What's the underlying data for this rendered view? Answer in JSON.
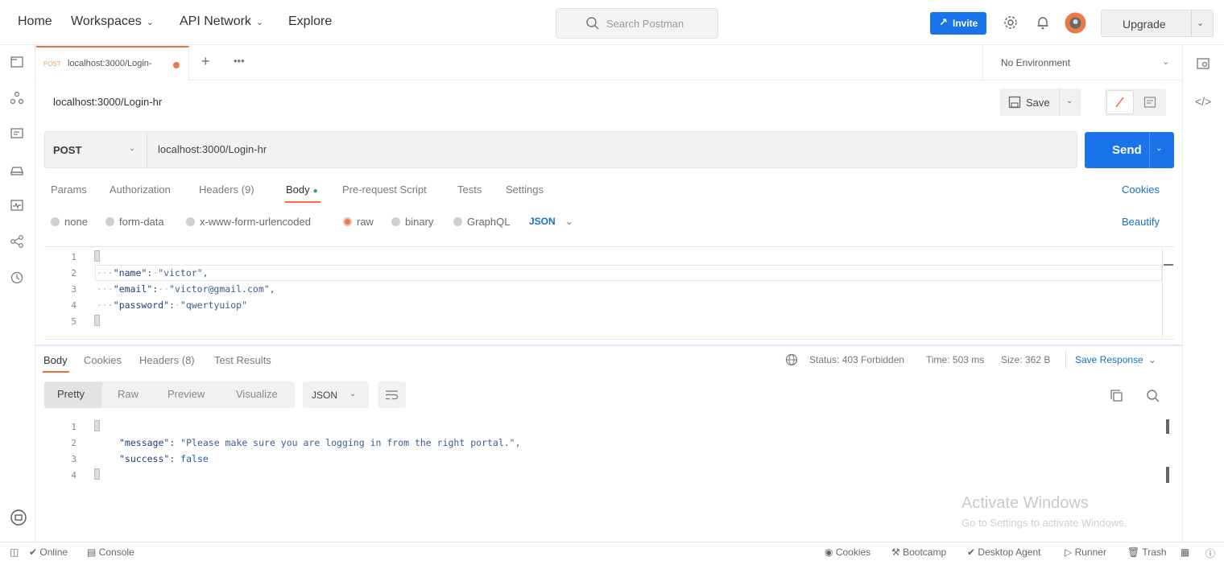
{
  "topnav": {
    "home": "Home",
    "workspaces": "Workspaces",
    "api_network": "API Network",
    "explore": "Explore",
    "search_placeholder": "Search Postman",
    "invite": "Invite",
    "upgrade": "Upgrade"
  },
  "tab": {
    "method": "POST",
    "url": "localhost:3000/Login-"
  },
  "environment": "No Environment",
  "request": {
    "title": "localhost:3000/Login-hr",
    "save": "Save",
    "method": "POST",
    "url": "localhost:3000/Login-hr",
    "send": "Send",
    "tabs": [
      "Params",
      "Authorization",
      "Headers (9)",
      "Body",
      "Pre-request Script",
      "Tests",
      "Settings"
    ],
    "cookies": "Cookies",
    "body_types": [
      "none",
      "form-data",
      "x-www-form-urlencoded",
      "raw",
      "binary",
      "GraphQL"
    ],
    "body_format": "JSON",
    "beautify": "Beautify",
    "body_lines": [
      {
        "n": "1",
        "text": "{"
      },
      {
        "n": "2",
        "key": "\"name\"",
        "value": "\"victor\","
      },
      {
        "n": "3",
        "key": "\"email\"",
        "value": "\"victor@gmail.com\","
      },
      {
        "n": "4",
        "key": "\"password\"",
        "value": "\"qwertyuiop\""
      },
      {
        "n": "5",
        "text": "}"
      }
    ]
  },
  "response": {
    "tabs": [
      "Body",
      "Cookies",
      "Headers (8)",
      "Test Results"
    ],
    "status": "Status: 403 Forbidden",
    "time": "Time: 503 ms",
    "size": "Size: 362 B",
    "save_response": "Save Response",
    "views": [
      "Pretty",
      "Raw",
      "Preview",
      "Visualize"
    ],
    "format": "JSON",
    "lines": [
      {
        "n": "1",
        "text": "{"
      },
      {
        "n": "2",
        "key": "\"message\"",
        "value": "\"Please make sure you are logging in from the right portal.\","
      },
      {
        "n": "3",
        "key": "\"success\"",
        "value": "false"
      },
      {
        "n": "4",
        "text": "}"
      }
    ]
  },
  "watermark": {
    "title": "Activate Windows",
    "subtitle": "Go to Settings to activate Windows."
  },
  "statusbar": {
    "online": "Online",
    "console": "Console",
    "cookies": "Cookies",
    "bootcamp": "Bootcamp",
    "desktop_agent": "Desktop Agent",
    "runner": "Runner",
    "trash": "Trash"
  },
  "colors": {
    "accent": "#f26b3a",
    "primary": "#1a73e8"
  }
}
